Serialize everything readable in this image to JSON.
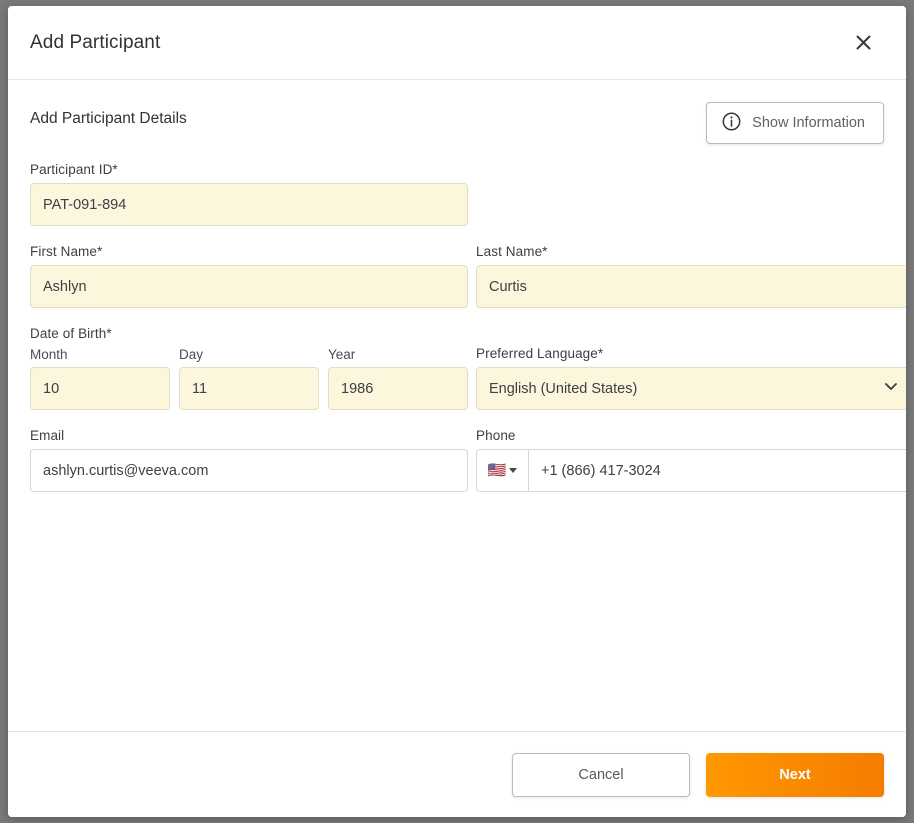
{
  "dialog": {
    "title": "Add Participant",
    "close_icon": "close-icon"
  },
  "body": {
    "section_heading": "Add Participant Details",
    "show_information": {
      "label": "Show Information",
      "icon": "info-circle-icon"
    }
  },
  "fields": {
    "participant_id": {
      "label": "Participant ID*",
      "value": "PAT-091-894",
      "placeholder": ""
    },
    "first_name": {
      "label": "First Name*",
      "value": "Ashlyn",
      "placeholder": ""
    },
    "last_name": {
      "label": "Last Name*",
      "value": "Curtis",
      "placeholder": ""
    },
    "date_of_birth": {
      "label": "Date of Birth*",
      "month": {
        "label": "Month",
        "value": "10",
        "placeholder": ""
      },
      "day": {
        "label": "Day",
        "value": "11",
        "placeholder": ""
      },
      "year": {
        "label": "Year",
        "value": "1986",
        "placeholder": ""
      }
    },
    "preferred_language": {
      "label": "Preferred Language*",
      "value": "English (United States)",
      "chevron_icon": "chevron-down-icon"
    },
    "email": {
      "label": "Email",
      "value": "ashlyn.curtis@veeva.com",
      "placeholder": ""
    },
    "phone": {
      "label": "Phone",
      "country_flag": "🇺🇸",
      "value": "+1 (866) 417-3024",
      "placeholder": ""
    }
  },
  "footer": {
    "cancel_label": "Cancel",
    "next_label": "Next"
  },
  "colors": {
    "accent_orange_start": "#FF9800",
    "accent_orange_end": "#F57C00",
    "required_field_fill": "#FCF6DD",
    "text_primary": "#3C4046",
    "border": "#D6D6DA"
  }
}
